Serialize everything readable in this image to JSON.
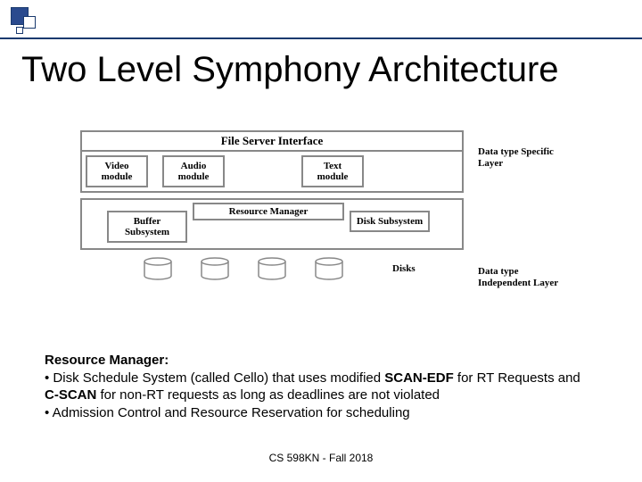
{
  "title": "Two Level Symphony Architecture",
  "diagram": {
    "file_server_interface": "File  Server  Interface",
    "video_module": "Video module",
    "audio_module": "Audio module",
    "text_module": "Text module",
    "layer1_label": "Data type Specific Layer",
    "resource_manager": "Resource Manager",
    "buffer_subsystem": "Buffer Subsystem",
    "disk_subsystem": "Disk Subsystem",
    "layer2_label": "Data type Independent Layer",
    "disks_label": "Disks"
  },
  "body": {
    "heading": "Resource Manager:",
    "bullet1_a": "• Disk Schedule System (called Cello)  that uses modified ",
    "bullet1_scan_edf": "SCAN-EDF",
    "bullet1_b": " for RT Requests and ",
    "bullet1_cscan": "C-SCAN",
    "bullet1_c": " for non-RT requests as long as deadlines are not violated",
    "bullet2": "• Admission Control and  Resource Reservation for scheduling"
  },
  "footer": "CS 598KN - Fall 2018"
}
